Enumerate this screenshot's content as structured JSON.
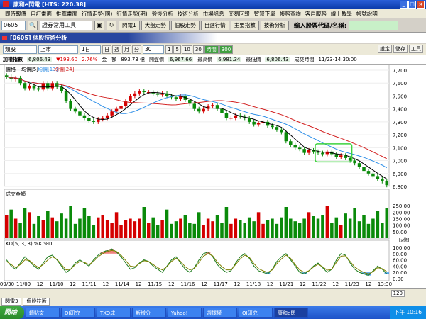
{
  "window": {
    "title": "康和e閃電 [HTS: 220.38]"
  },
  "menu": [
    "即時報價",
    "自訂畫面",
    "推薦畫面",
    "行情走勢(國)",
    "行情走勢(期)",
    "盤後分析",
    "技術分析",
    "市場訊息",
    "交易回報",
    "智慧下單",
    "帳務查詢",
    "客戶服務",
    "線上教學",
    "帳號說明"
  ],
  "toolbar": {
    "code": "0605",
    "tool_select": "證券常用工具",
    "buttons": [
      "閃電1",
      "大盤走勢",
      "個股走勢",
      "自選行情",
      "主要指數",
      "技術分析"
    ],
    "stock_query_label": "輸入股票代碼/名稱:"
  },
  "panel": {
    "title": "[0605] 個股技術分析"
  },
  "controls": {
    "type_select": "類股",
    "market_select": "上市",
    "period_select": "1日",
    "period_buttons": [
      "日",
      "週",
      "月",
      "分"
    ],
    "minute_select": "30",
    "minute_buttons": [
      "1",
      "5",
      "10",
      "30",
      "時間",
      "300"
    ],
    "right_buttons": [
      "設定",
      "儲存",
      "工具"
    ]
  },
  "infobar": {
    "name": "加權指數",
    "price": "6,806.43",
    "change": "▼193.60",
    "pct": "2.76%",
    "amount_label": "金　額",
    "amount": "893.73 億",
    "open_label": "開盤價",
    "open": "6,967.66",
    "high_label": "最高價",
    "high": "6,981.34",
    "low_label": "最低價",
    "low": "6,806.43",
    "time_label": "成交時間",
    "time": "11/23-14:30:00"
  },
  "chart_data": [
    {
      "type": "line",
      "title": "價格",
      "legend": [
        "均價[5]",
        "均價[13]",
        "均價[24]"
      ],
      "x": [
        "09/30",
        "11/09",
        "11/10",
        "11/11",
        "11/14",
        "11/15",
        "11/16",
        "11/17",
        "11/18",
        "11/21",
        "11/22",
        "11/23",
        "13:30"
      ],
      "ylim": [
        6800,
        7700
      ],
      "yticks": [
        6800,
        6900,
        7000,
        7100,
        7200,
        7300,
        7400,
        7500,
        7600,
        7700
      ],
      "close": [
        7650,
        7630,
        7640,
        7600,
        7560,
        7580,
        7560,
        7550,
        7600,
        7560,
        7600,
        7570,
        7540,
        7460,
        7400,
        7380,
        7350,
        7330,
        7310,
        7300,
        7320,
        7330,
        7350,
        7380,
        7400,
        7420,
        7460,
        7500,
        7520,
        7540,
        7530,
        7530,
        7520,
        7510,
        7520,
        7500,
        7490,
        7480,
        7500,
        7470,
        7440,
        7400,
        7380,
        7400,
        7420,
        7430,
        7400,
        7370,
        7330,
        7330,
        7350,
        7340,
        7330,
        7300,
        7280,
        7290,
        7300,
        7270,
        7260,
        7240,
        7220,
        7150,
        7120,
        7100,
        7090,
        7060,
        7080,
        7070,
        7060,
        7050,
        7070,
        7050,
        7030,
        7040,
        7020,
        7000,
        6980,
        6950,
        6920,
        6900,
        6880,
        6860,
        6840,
        6810
      ]
    },
    {
      "type": "bar",
      "title": "成交金額",
      "ylim": [
        0,
        300
      ],
      "yticks": [
        50,
        100,
        150,
        200,
        250
      ],
      "ylabel": "[x億]",
      "values": [
        180,
        220,
        150,
        120,
        230,
        200,
        110,
        170,
        140,
        210,
        160,
        130,
        190,
        150,
        250,
        110,
        150,
        230,
        170,
        100,
        160,
        180,
        140,
        120,
        200,
        100,
        140,
        150,
        130,
        150,
        240,
        120,
        160,
        100,
        140,
        220,
        110,
        130,
        150,
        180,
        120,
        110,
        200,
        100,
        150,
        130,
        180,
        120,
        240,
        110,
        150,
        140,
        120,
        160,
        130,
        200,
        110,
        140,
        150,
        110,
        160,
        240,
        150,
        130,
        120,
        150,
        200,
        170,
        150,
        180,
        250,
        120,
        160,
        100,
        190,
        150,
        230,
        130,
        180,
        110,
        150,
        210,
        120,
        230
      ]
    },
    {
      "type": "line",
      "title": "KD(5, 3, 3) %K %D",
      "ylim": [
        0,
        100
      ],
      "yticks": [
        0,
        20,
        40,
        60,
        80,
        100
      ],
      "k": [
        60,
        40,
        30,
        50,
        70,
        55,
        40,
        30,
        50,
        70,
        75,
        60,
        40,
        20,
        30,
        50,
        60,
        50,
        40,
        60,
        75,
        85,
        90,
        95,
        85,
        70,
        50,
        30,
        35,
        50,
        60,
        55,
        40,
        30,
        20,
        40,
        60,
        70,
        50,
        30,
        20,
        35,
        60,
        80,
        85,
        70,
        45,
        30,
        20,
        25,
        50,
        70,
        80,
        65,
        40,
        25,
        20,
        15,
        30,
        55,
        70,
        80,
        60,
        40,
        20,
        15,
        25,
        40,
        50,
        35,
        20,
        30,
        60,
        80,
        75,
        50,
        30,
        20,
        15,
        10,
        25,
        40,
        30,
        15
      ],
      "d": [
        55,
        45,
        35,
        45,
        60,
        58,
        45,
        35,
        45,
        60,
        70,
        62,
        45,
        28,
        30,
        45,
        55,
        52,
        45,
        55,
        70,
        80,
        87,
        90,
        87,
        75,
        58,
        40,
        38,
        48,
        57,
        55,
        45,
        35,
        28,
        38,
        55,
        65,
        55,
        38,
        28,
        33,
        52,
        72,
        80,
        73,
        53,
        38,
        28,
        28,
        45,
        63,
        75,
        68,
        48,
        32,
        25,
        20,
        28,
        48,
        63,
        75,
        65,
        45,
        28,
        20,
        25,
        37,
        46,
        38,
        27,
        30,
        52,
        72,
        73,
        55,
        37,
        27,
        20,
        15,
        22,
        35,
        32,
        22
      ]
    }
  ],
  "xaxis_labels": [
    "09/30",
    "11/09",
    "12",
    "11/10",
    "12",
    "11/11",
    "12",
    "11/14",
    "12",
    "11/15",
    "12",
    "11/16",
    "12",
    "11/17",
    "12",
    "11/18",
    "12",
    "11/21",
    "12",
    "11/22",
    "12",
    "11/23",
    "12",
    "13:30"
  ],
  "scroll": {
    "zoom": "120"
  },
  "bottom_tabs": [
    "閃電3",
    "個股技術"
  ],
  "taskbar": {
    "start": "開始",
    "tasks": [
      "轉貼文",
      "OI研究",
      "TXO成",
      "新增分",
      "Yahoo!",
      "選擇權",
      "OI研究",
      "康和e閃"
    ],
    "clock": "下午 10:16"
  },
  "colors": {
    "ma5": "#000000",
    "ma13": "#2e8fe8",
    "ma24": "#d22020",
    "up": "#d40000",
    "down": "#0a8a0a",
    "k": "#1a7a1a",
    "d": "#808000"
  }
}
